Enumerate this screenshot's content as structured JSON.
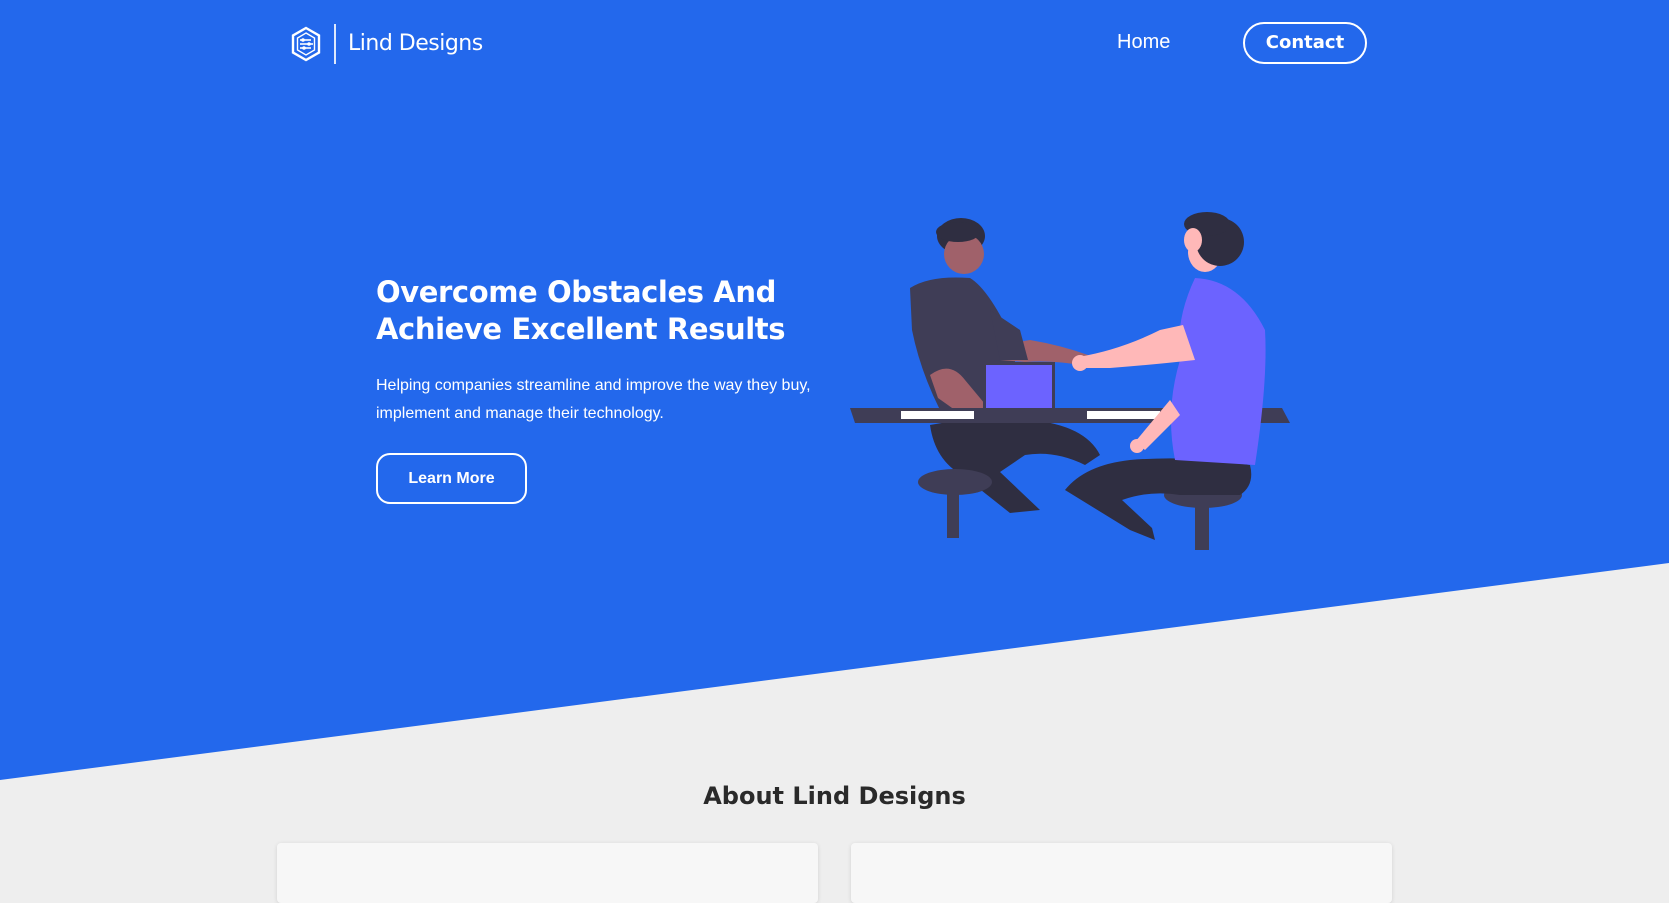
{
  "nav": {
    "brand": "Lind Designs",
    "home_label": "Home",
    "contact_label": "Contact"
  },
  "hero": {
    "title_line1": "Overcome Obstacles And",
    "title_line2": "Achieve Excellent Results",
    "subtitle_line1": "Helping companies streamline and improve the way they buy,",
    "subtitle_line2": "implement and manage their technology.",
    "cta_label": "Learn More"
  },
  "about": {
    "title": "About Lind Designs"
  },
  "colors": {
    "hero_background": "#2368ec",
    "page_background": "#eeeeee",
    "accent_purple": "#6c63ff",
    "dark_figure": "#3f3d56"
  },
  "icons": {
    "logo": "hexagon-logo-icon",
    "illustration": "handshake-illustration"
  }
}
